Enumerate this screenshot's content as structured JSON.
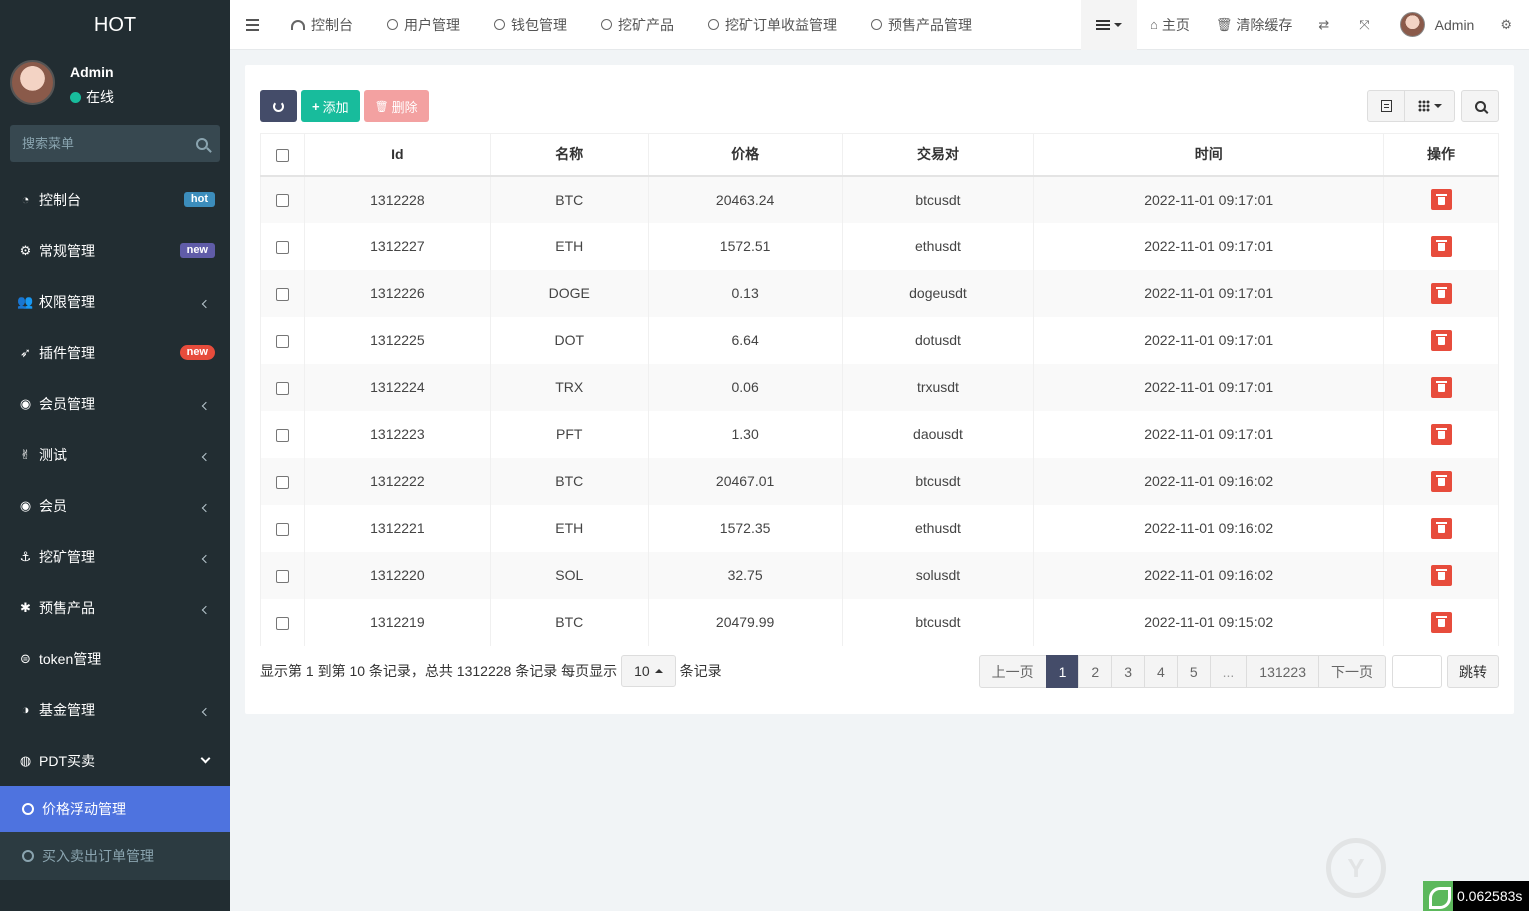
{
  "sidebar": {
    "logo": "HOT",
    "user": {
      "name": "Admin",
      "status": "在线"
    },
    "search_placeholder": "搜索菜单",
    "items": [
      {
        "label": "控制台",
        "icon": "dashboard-icon",
        "badge": "hot"
      },
      {
        "label": "常规管理",
        "icon": "cogs-icon",
        "badge": "new"
      },
      {
        "label": "权限管理",
        "icon": "users-icon"
      },
      {
        "label": "插件管理",
        "icon": "rocket-icon",
        "badge": "new"
      },
      {
        "label": "会员管理",
        "icon": "user-circle-icon"
      },
      {
        "label": "测试",
        "icon": "hand-peace-icon"
      },
      {
        "label": "会员",
        "icon": "user-circle-icon"
      },
      {
        "label": "挖矿管理",
        "icon": "anchor-icon"
      },
      {
        "label": "预售产品",
        "icon": "asterisk-icon"
      },
      {
        "label": "token管理",
        "icon": "globe-icon"
      },
      {
        "label": "基金管理",
        "icon": "adjust-icon"
      },
      {
        "label": "PDT买卖",
        "icon": "compass-icon"
      }
    ],
    "submenu": [
      {
        "label": "价格浮动管理",
        "active": true
      },
      {
        "label": "买入卖出订单管理",
        "active": false
      }
    ]
  },
  "topbar": {
    "tabs": [
      {
        "label": "控制台",
        "icon": "dashboard-icon"
      },
      {
        "label": "用户管理",
        "icon": "circle-icon"
      },
      {
        "label": "钱包管理",
        "icon": "circle-icon"
      },
      {
        "label": "挖矿产品",
        "icon": "circle-icon"
      },
      {
        "label": "挖矿订单收益管理",
        "icon": "circle-icon"
      },
      {
        "label": "预售产品管理",
        "icon": "circle-icon"
      }
    ],
    "home": "主页",
    "clear_cache": "清除缓存",
    "admin": "Admin"
  },
  "toolbar": {
    "add": "添加",
    "delete": "删除"
  },
  "table": {
    "headers": [
      "Id",
      "名称",
      "价格",
      "交易对",
      "时间",
      "操作"
    ],
    "rows": [
      [
        "1312228",
        "BTC",
        "20463.24",
        "btcusdt",
        "2022-11-01 09:17:01"
      ],
      [
        "1312227",
        "ETH",
        "1572.51",
        "ethusdt",
        "2022-11-01 09:17:01"
      ],
      [
        "1312226",
        "DOGE",
        "0.13",
        "dogeusdt",
        "2022-11-01 09:17:01"
      ],
      [
        "1312225",
        "DOT",
        "6.64",
        "dotusdt",
        "2022-11-01 09:17:01"
      ],
      [
        "1312224",
        "TRX",
        "0.06",
        "trxusdt",
        "2022-11-01 09:17:01"
      ],
      [
        "1312223",
        "PFT",
        "1.30",
        "daousdt",
        "2022-11-01 09:17:01"
      ],
      [
        "1312222",
        "BTC",
        "20467.01",
        "btcusdt",
        "2022-11-01 09:16:02"
      ],
      [
        "1312221",
        "ETH",
        "1572.35",
        "ethusdt",
        "2022-11-01 09:16:02"
      ],
      [
        "1312220",
        "SOL",
        "32.75",
        "solusdt",
        "2022-11-01 09:16:02"
      ],
      [
        "1312219",
        "BTC",
        "20479.99",
        "btcusdt",
        "2022-11-01 09:15:02"
      ]
    ]
  },
  "pager": {
    "info_prefix": "显示第 1 到第 10 条记录，总共 1312228 条记录 每页显示",
    "page_size": "10",
    "info_suffix": "条记录",
    "prev": "上一页",
    "pages": [
      "1",
      "2",
      "3",
      "4",
      "5",
      "...",
      "131223"
    ],
    "next": "下一页",
    "jump": "跳转"
  },
  "timer": "0.062583s",
  "colors": {
    "sidebar_bg": "#222d32",
    "active_menu": "#4e73df",
    "primary_dark": "#444c69",
    "success": "#18bc9c",
    "danger": "#e74c3c"
  }
}
